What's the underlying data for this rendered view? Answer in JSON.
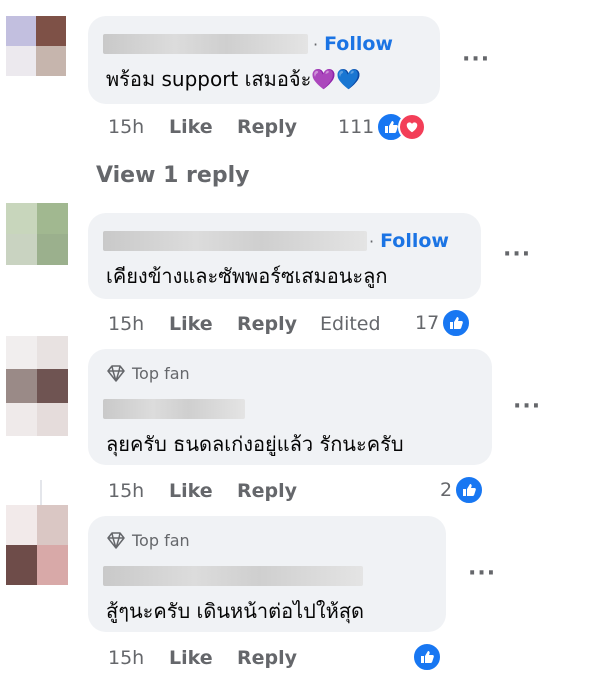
{
  "comments": [
    {
      "follow": "Follow",
      "text": "พร้อม support เสมอจ้ะ💜💙",
      "time": "15h",
      "like_label": "Like",
      "reply_label": "Reply",
      "reaction_count": "111",
      "reactions": [
        "like-icon",
        "love-icon"
      ]
    },
    {
      "follow": "Follow",
      "text": "เคียงข้างและซัพพอร์ซเสมอนะลูก",
      "time": "15h",
      "like_label": "Like",
      "reply_label": "Reply",
      "edited_label": "Edited",
      "reaction_count": "17",
      "reactions": [
        "like-icon"
      ]
    },
    {
      "badge": "Top fan",
      "text": "ลุยครับ ธนดลเก่งอยู่แล้ว รักนะครับ",
      "time": "15h",
      "like_label": "Like",
      "reply_label": "Reply",
      "reaction_count": "2",
      "reactions": [
        "like-icon"
      ]
    },
    {
      "badge": "Top fan",
      "text": "สู้ๆนะครับ เดินหน้าต่อไปให้สุด",
      "time": "15h",
      "like_label": "Like",
      "reply_label": "Reply",
      "reaction_count": "",
      "reactions": [
        "like-icon"
      ]
    }
  ],
  "view_replies": "View 1 reply",
  "more_icon": "more-options-icon",
  "colors": {
    "link": "#1b74e4",
    "muted": "#65676b",
    "bubble": "#f0f2f5",
    "like": "#1877f2",
    "love": "#f33e58"
  }
}
